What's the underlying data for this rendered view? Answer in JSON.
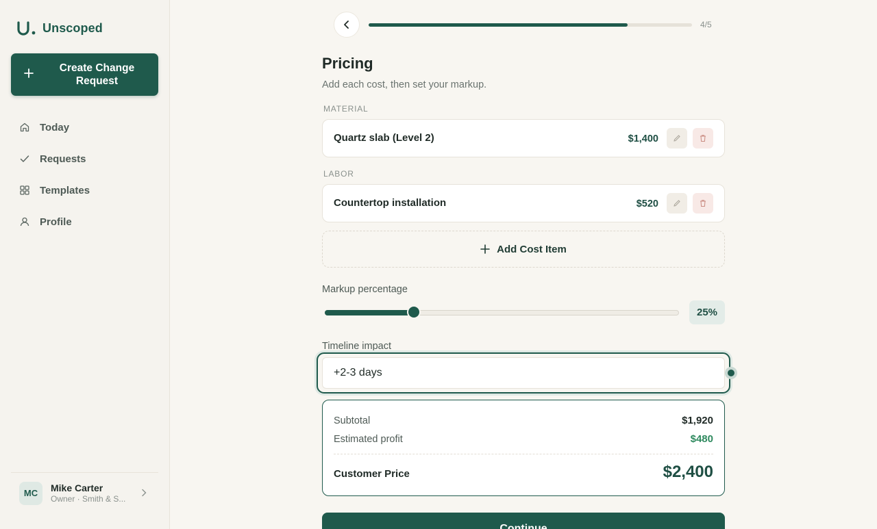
{
  "brand": {
    "name": "Unscoped"
  },
  "sidebar": {
    "create_button": "Create Change Request",
    "items": [
      {
        "label": "Today",
        "icon": "home-icon"
      },
      {
        "label": "Requests",
        "icon": "check-icon"
      },
      {
        "label": "Templates",
        "icon": "grid-icon"
      },
      {
        "label": "Profile",
        "icon": "user-icon"
      }
    ],
    "user": {
      "initials": "MC",
      "name": "Mike Carter",
      "role": "Owner · Smith & S..."
    }
  },
  "progress": {
    "step_label": "4/5",
    "fraction": 0.8
  },
  "page": {
    "title": "Pricing",
    "subtitle": "Add each cost, then set your markup."
  },
  "costs": [
    {
      "category": "MATERIAL",
      "name": "Quartz slab (Level 2)",
      "price": "$1,400"
    },
    {
      "category": "LABOR",
      "name": "Countertop installation",
      "price": "$520"
    }
  ],
  "add_cost_label": "Add Cost Item",
  "markup": {
    "label": "Markup percentage",
    "value": 25,
    "display": "25%",
    "slider_fraction": 0.25
  },
  "timeline": {
    "label": "Timeline impact",
    "value": "+2-3 days"
  },
  "summary": {
    "subtotal_label": "Subtotal",
    "subtotal": "$1,920",
    "profit_label": "Estimated profit",
    "profit": "$480",
    "customer_price_label": "Customer Price",
    "customer_price": "$2,400"
  },
  "continue_label": "Continue",
  "colors": {
    "accent": "#1f5a4c",
    "profit": "#2f8a5f",
    "background": "#f8f6f1"
  }
}
